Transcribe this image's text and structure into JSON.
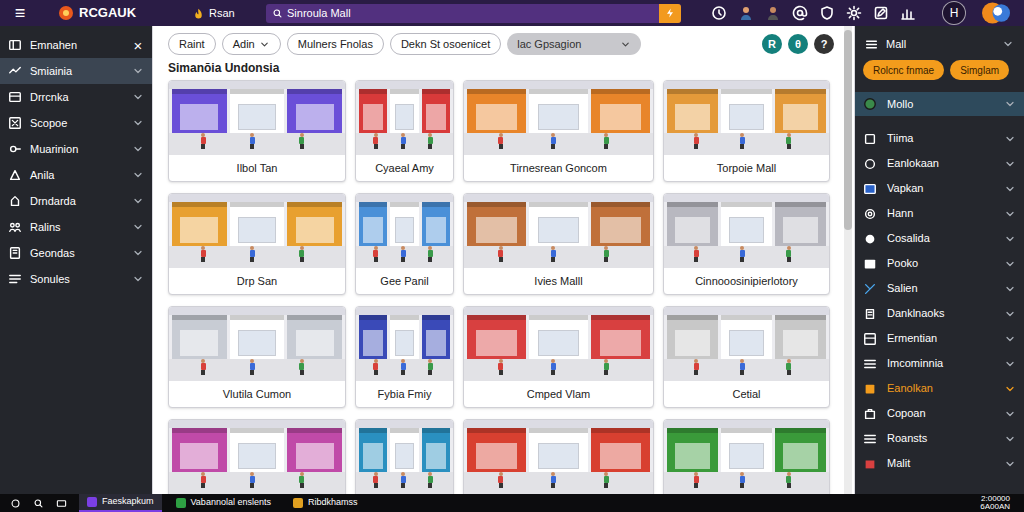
{
  "topbar": {
    "menu": "≡",
    "logo": "RCGAUK",
    "app": "Rsan",
    "search": {
      "value": "Sinroula Mall"
    },
    "user_initial": "H"
  },
  "left_sidebar": {
    "items": [
      {
        "label": "Emnahen",
        "kind": "closable",
        "close": "×",
        "selected": false
      },
      {
        "label": "Smiainia",
        "kind": "expandable",
        "selected": true
      },
      {
        "label": "Drrcnka",
        "kind": "expandable",
        "selected": false
      },
      {
        "label": "Scopoe",
        "kind": "expandable",
        "selected": false
      },
      {
        "label": "Muarinion",
        "kind": "expandable",
        "selected": false
      },
      {
        "label": "Anila",
        "kind": "expandable",
        "selected": false
      },
      {
        "label": "Drndarda",
        "kind": "expandable",
        "selected": false
      },
      {
        "label": "Ralins",
        "kind": "expandable",
        "selected": false
      },
      {
        "label": "Geondas",
        "kind": "expandable",
        "selected": false
      },
      {
        "label": "Sonules",
        "kind": "expandable",
        "selected": false
      }
    ]
  },
  "toolbar": {
    "filters": [
      {
        "label": "Raint",
        "kind": "button"
      },
      {
        "label": "Adin",
        "kind": "dropdown"
      },
      {
        "label": "Mulners Fnolas",
        "kind": "button"
      },
      {
        "label": "Dekn St osoenicet",
        "kind": "button"
      },
      {
        "label": "lac Gpsagion",
        "kind": "select"
      }
    ],
    "actions": [
      {
        "label": "R",
        "color": "#14807c"
      },
      {
        "label": "θ",
        "color": "#14807c"
      },
      {
        "label": "?",
        "color": "#333333"
      }
    ]
  },
  "section_title": "Simanōia Undonsia",
  "cards": [
    {
      "caption": "Ilbol Tan",
      "color": "#6a4fd8"
    },
    {
      "caption": "Cyaeal Amy",
      "color": "#d83a3a"
    },
    {
      "caption": "Tirnesrean Goncom",
      "color": "#e8852a"
    },
    {
      "caption": "Torpoie Mall",
      "color": "#e49a3a"
    },
    {
      "caption": "Drp San",
      "color": "#e8a030"
    },
    {
      "caption": "Gee Panil",
      "color": "#4a90d8"
    },
    {
      "caption": "Ivies Malll",
      "color": "#c0703a"
    },
    {
      "caption": "Cinnooosinipierlotory",
      "color": "#b8b8c0"
    },
    {
      "caption": "Vlutila Cumon",
      "color": "#c8ccd4"
    },
    {
      "caption": "Fybia Fmiy",
      "color": "#3a4ab8"
    },
    {
      "caption": "Cmped Vlam",
      "color": "#d84040"
    },
    {
      "caption": "Cetial",
      "color": "#c8c8c8"
    },
    {
      "color": "#c04aa8"
    },
    {
      "color": "#2a90c0"
    },
    {
      "color": "#d84030"
    },
    {
      "color": "#3a9a3a"
    }
  ],
  "right_panel": {
    "header": "Mall",
    "buttons": [
      "Rolcnc fnmae",
      "Simglam"
    ],
    "items": [
      {
        "label": "Mollo",
        "kind": "group",
        "selected": false
      },
      {
        "label": "Tiima",
        "kind": "item",
        "selected": false
      },
      {
        "label": "Eanlokaan",
        "kind": "item",
        "selected": false
      },
      {
        "label": "Vapkan",
        "kind": "item",
        "selected": false
      },
      {
        "label": "Hann",
        "kind": "item",
        "selected": false
      },
      {
        "label": "Cosalida",
        "kind": "item",
        "selected": false
      },
      {
        "label": "Pooko",
        "kind": "item",
        "selected": false
      },
      {
        "label": "Salien",
        "kind": "item",
        "selected": false
      },
      {
        "label": "Danklnaoks",
        "kind": "item",
        "selected": false
      },
      {
        "label": "Ermentian",
        "kind": "item",
        "selected": false
      },
      {
        "label": "Imcominnia",
        "kind": "item",
        "selected": false
      },
      {
        "label": "Eanolkan",
        "kind": "item",
        "selected": true
      },
      {
        "label": "Copoan",
        "kind": "item",
        "selected": false
      },
      {
        "label": "Roansts",
        "kind": "item",
        "selected": false
      },
      {
        "label": "Malit",
        "kind": "item",
        "selected": false
      }
    ]
  },
  "taskbar": {
    "items": [
      {
        "label": "Faeskapkum",
        "color": "#7b3fe4",
        "selected": true
      },
      {
        "label": "Vabannolal enslents",
        "color": "#2ea043",
        "selected": false
      },
      {
        "label": "Ribdkhamss",
        "color": "#e0a020",
        "selected": false
      }
    ],
    "clock": [
      "2:00000",
      "6A00AN"
    ]
  }
}
